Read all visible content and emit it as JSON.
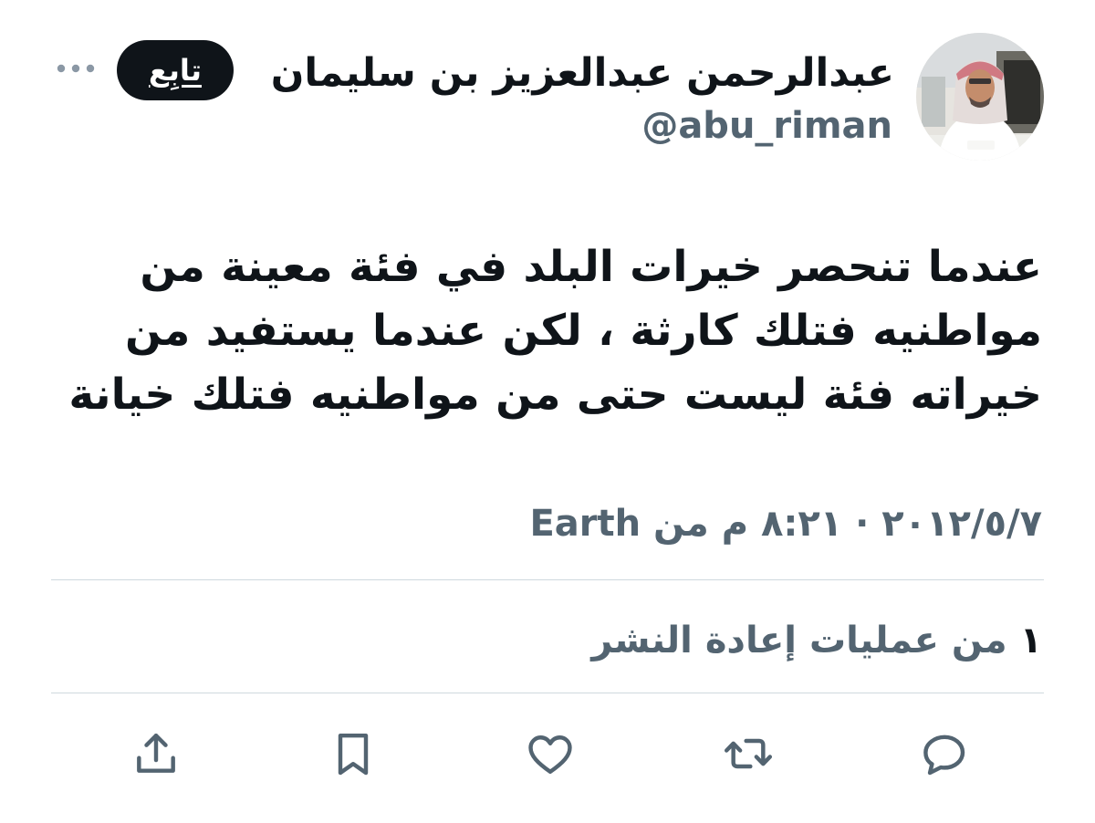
{
  "header": {
    "display_name": "عبدالرحمن عبدالعزيز بن سليمان",
    "handle": "@abu_riman",
    "follow_label": "تابِع",
    "avatar_icon": "profile-photo",
    "more_icon": "more-dots-icon"
  },
  "tweet": {
    "text": "عندما تنحصر خيرات البلد في فئة معينة من مواطنيه فتلك كارثة ، لكن عندما يستفيد من خيراته فئة ليست حتى من مواطنيه فتلك خيانة",
    "date": "٢٠١٢/٥/٧",
    "separator": "·",
    "time": "٨:٢١ م",
    "source_prefix": "من",
    "source": "Earth"
  },
  "stats": {
    "retweet_count": "١",
    "retweet_label": "من عمليات إعادة النشر"
  },
  "actions": [
    {
      "name": "reply-icon"
    },
    {
      "name": "retweet-icon"
    },
    {
      "name": "like-icon"
    },
    {
      "name": "bookmark-icon"
    },
    {
      "name": "share-icon"
    }
  ],
  "colors": {
    "text_primary": "#0f1419",
    "text_secondary": "#536471",
    "divider": "#cfd9de",
    "button_bg": "#0f1419",
    "button_text": "#ffffff"
  }
}
